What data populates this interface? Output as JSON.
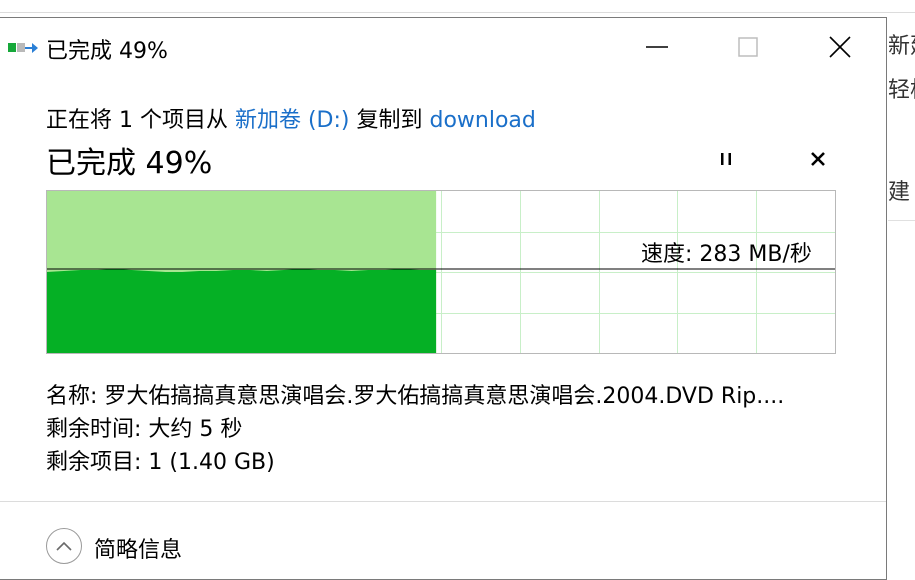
{
  "background_window": {
    "text_new": "新建",
    "text_light": "轻松",
    "text_build": "建"
  },
  "titlebar": {
    "title": "已完成 49%",
    "icon": "copy-progress-icon",
    "minimize_icon": "minimize-icon",
    "maximize_icon": "maximize-icon",
    "close_icon": "close-icon"
  },
  "copy_description": {
    "prefix": "正在将 1 个项目从 ",
    "source": "新加卷 (D:)",
    "middle": " 复制到 ",
    "destination": "download"
  },
  "progress": {
    "heading": "已完成 49%",
    "percent": 49,
    "pause_icon": "pause-icon",
    "cancel_icon": "cancel-icon",
    "speed_label": "速度: 283 MB/秒"
  },
  "colors": {
    "progress_fill": "#a8e592",
    "speed_fill": "#05b025",
    "grid": "#c8efc8",
    "link": "#1a6fc9"
  },
  "info": {
    "name_line": "名称: 罗大佑搞搞真意思演唱会.罗大佑搞搞真意思演唱会.2004.DVD Rip....",
    "time_line": "剩余时间: 大约 5 秒",
    "items_line": "剩余项目: 1 (1.40 GB)"
  },
  "footer": {
    "toggle_icon": "chevron-up-icon",
    "label": "简略信息"
  }
}
